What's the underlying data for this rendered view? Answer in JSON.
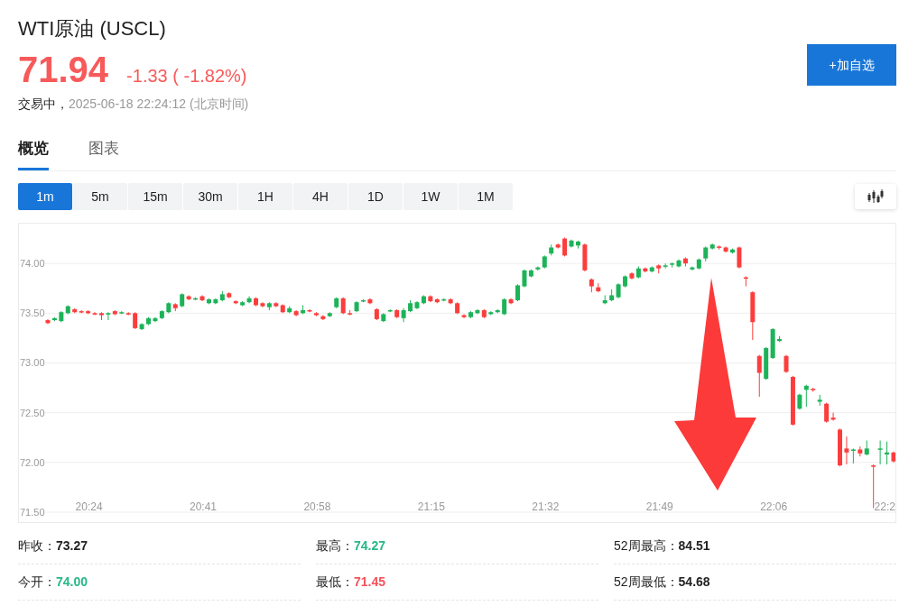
{
  "header": {
    "title": "WTI原油 (USCL)",
    "price": "71.94",
    "change": "-1.33 ( -1.82%)",
    "status": "交易中，",
    "timestamp": "2025-06-18 22:24:12 (北京时间)",
    "watch_button": "+加自选"
  },
  "tabs": [
    {
      "label": "概览",
      "selected": true
    },
    {
      "label": "图表",
      "selected": false
    }
  ],
  "intervals": [
    {
      "label": "1m",
      "selected": true
    },
    {
      "label": "5m",
      "selected": false
    },
    {
      "label": "15m",
      "selected": false
    },
    {
      "label": "30m",
      "selected": false
    },
    {
      "label": "1H",
      "selected": false
    },
    {
      "label": "4H",
      "selected": false
    },
    {
      "label": "1D",
      "selected": false
    },
    {
      "label": "1W",
      "selected": false
    },
    {
      "label": "1M",
      "selected": false
    }
  ],
  "chart": {
    "chart_data": {
      "type": "candlestick",
      "grid": true,
      "xlim": [
        1213.7,
        1344.27
      ],
      "ylim": [
        71.4,
        74.4
      ],
      "yticks": [
        {
          "value": 74,
          "label": "74.00"
        },
        {
          "value": 73.5,
          "label": "73.50"
        },
        {
          "value": 73,
          "label": "73.00"
        },
        {
          "value": 72.5,
          "label": "72.50"
        },
        {
          "value": 72,
          "label": "72.00"
        },
        {
          "value": 71.5,
          "label": "71.50"
        }
      ],
      "xticks": [
        {
          "value": 1224,
          "label": "20:24"
        },
        {
          "value": 1241,
          "label": "20:41"
        },
        {
          "value": 1258,
          "label": "20:58"
        },
        {
          "value": 1275,
          "label": "21:15"
        },
        {
          "value": 1292,
          "label": "21:32"
        },
        {
          "value": 1309,
          "label": "21:49"
        },
        {
          "value": 1326,
          "label": "22:06"
        },
        {
          "value": 1343,
          "label": "22:2"
        }
      ],
      "x": [
        1218,
        1219,
        1220,
        1221,
        1222,
        1223,
        1224,
        1225,
        1226,
        1227,
        1228,
        1229,
        1230,
        1231,
        1232,
        1233,
        1234,
        1235,
        1236,
        1237,
        1238,
        1239,
        1240,
        1241,
        1242,
        1243,
        1244,
        1245,
        1246,
        1247,
        1248,
        1249,
        1250,
        1251,
        1252,
        1253,
        1254,
        1255,
        1256,
        1257,
        1258,
        1259,
        1260,
        1261,
        1262,
        1263,
        1264,
        1265,
        1266,
        1267,
        1268,
        1269,
        1270,
        1271,
        1272,
        1273,
        1274,
        1275,
        1276,
        1277,
        1278,
        1279,
        1280,
        1281,
        1282,
        1283,
        1284,
        1285,
        1286,
        1287,
        1288,
        1289,
        1290,
        1291,
        1292,
        1293,
        1294,
        1295,
        1296,
        1297,
        1298,
        1299,
        1300,
        1301,
        1302,
        1303,
        1304,
        1305,
        1306,
        1307,
        1308,
        1309,
        1310,
        1311,
        1312,
        1313,
        1314,
        1315,
        1316,
        1317,
        1318,
        1319,
        1320,
        1321,
        1322,
        1323,
        1324,
        1325,
        1326,
        1327,
        1328,
        1329,
        1330,
        1331,
        1332,
        1333,
        1334,
        1335,
        1336,
        1337,
        1338,
        1339,
        1340,
        1341,
        1342,
        1343,
        1344
      ],
      "ohlc": [
        [
          73.43,
          73.44,
          73.39,
          73.4
        ],
        [
          73.43,
          73.46,
          73.42,
          73.45
        ],
        [
          73.42,
          73.52,
          73.41,
          73.51
        ],
        [
          73.5,
          73.58,
          73.49,
          73.57
        ],
        [
          73.54,
          73.55,
          73.5,
          73.51
        ],
        [
          73.52,
          73.53,
          73.5,
          73.51
        ],
        [
          73.52,
          73.53,
          73.49,
          73.5
        ],
        [
          73.5,
          73.51,
          73.48,
          73.49
        ],
        [
          73.5,
          73.51,
          73.43,
          73.48
        ],
        [
          73.49,
          73.51,
          73.43,
          73.5
        ],
        [
          73.52,
          73.53,
          73.48,
          73.49
        ],
        [
          73.5,
          73.52,
          73.49,
          73.51
        ],
        [
          73.5,
          73.51,
          73.48,
          73.49
        ],
        [
          73.5,
          73.51,
          73.34,
          73.35
        ],
        [
          73.34,
          73.4,
          73.33,
          73.39
        ],
        [
          73.39,
          73.46,
          73.38,
          73.45
        ],
        [
          73.42,
          73.46,
          73.41,
          73.45
        ],
        [
          73.45,
          73.53,
          73.44,
          73.52
        ],
        [
          73.51,
          73.61,
          73.5,
          73.6
        ],
        [
          73.59,
          73.6,
          73.52,
          73.55
        ],
        [
          73.57,
          73.7,
          73.56,
          73.69
        ],
        [
          73.67,
          73.68,
          73.63,
          73.64
        ],
        [
          73.64,
          73.66,
          73.63,
          73.65
        ],
        [
          73.67,
          73.68,
          73.62,
          73.63
        ],
        [
          73.6,
          73.65,
          73.59,
          73.64
        ],
        [
          73.6,
          73.65,
          73.59,
          73.64
        ],
        [
          73.63,
          73.72,
          73.62,
          73.69
        ],
        [
          73.7,
          73.71,
          73.65,
          73.66
        ],
        [
          73.62,
          73.63,
          73.59,
          73.6
        ],
        [
          73.58,
          73.62,
          73.57,
          73.61
        ],
        [
          73.61,
          73.67,
          73.6,
          73.65
        ],
        [
          73.65,
          73.66,
          73.57,
          73.58
        ],
        [
          73.6,
          73.61,
          73.56,
          73.57
        ],
        [
          73.56,
          73.61,
          73.53,
          73.6
        ],
        [
          73.6,
          73.61,
          73.56,
          73.57
        ],
        [
          73.58,
          73.59,
          73.5,
          73.51
        ],
        [
          73.51,
          73.57,
          73.5,
          73.55
        ],
        [
          73.52,
          73.53,
          73.47,
          73.48
        ],
        [
          73.5,
          73.58,
          73.49,
          73.53
        ],
        [
          73.53,
          73.54,
          73.51,
          73.52
        ],
        [
          73.5,
          73.51,
          73.47,
          73.48
        ],
        [
          73.47,
          73.48,
          73.43,
          73.44
        ],
        [
          73.47,
          73.51,
          73.46,
          73.5
        ],
        [
          73.56,
          73.66,
          73.55,
          73.65
        ],
        [
          73.65,
          73.66,
          73.49,
          73.5
        ],
        [
          73.5,
          73.53,
          73.48,
          73.49
        ],
        [
          73.52,
          73.62,
          73.51,
          73.61
        ],
        [
          73.62,
          73.64,
          73.61,
          73.63
        ],
        [
          73.64,
          73.65,
          73.59,
          73.6
        ],
        [
          73.54,
          73.55,
          73.43,
          73.44
        ],
        [
          73.42,
          73.5,
          73.41,
          73.49
        ],
        [
          73.52,
          73.54,
          73.51,
          73.53
        ],
        [
          73.53,
          73.54,
          73.45,
          73.46
        ],
        [
          73.45,
          73.55,
          73.41,
          73.53
        ],
        [
          73.52,
          73.63,
          73.51,
          73.6
        ],
        [
          73.55,
          73.62,
          73.54,
          73.61
        ],
        [
          73.6,
          73.68,
          73.59,
          73.67
        ],
        [
          73.67,
          73.68,
          73.61,
          73.62
        ],
        [
          73.64,
          73.65,
          73.6,
          73.61
        ],
        [
          73.63,
          73.65,
          73.62,
          73.64
        ],
        [
          73.64,
          73.65,
          73.59,
          73.6
        ],
        [
          73.6,
          73.61,
          73.49,
          73.5
        ],
        [
          73.48,
          73.49,
          73.45,
          73.46
        ],
        [
          73.46,
          73.52,
          73.45,
          73.51
        ],
        [
          73.5,
          73.54,
          73.49,
          73.53
        ],
        [
          73.53,
          73.54,
          73.45,
          73.46
        ],
        [
          73.49,
          73.52,
          73.48,
          73.51
        ],
        [
          73.51,
          73.54,
          73.5,
          73.53
        ],
        [
          73.49,
          73.65,
          73.48,
          73.64
        ],
        [
          73.64,
          73.65,
          73.59,
          73.6
        ],
        [
          73.63,
          73.79,
          73.62,
          73.78
        ],
        [
          73.77,
          73.94,
          73.76,
          73.93
        ],
        [
          73.87,
          73.94,
          73.86,
          73.93
        ],
        [
          73.94,
          73.97,
          73.93,
          73.96
        ],
        [
          73.96,
          74.08,
          73.95,
          74.07
        ],
        [
          74.1,
          74.19,
          74.08,
          74.16
        ],
        [
          74.19,
          74.2,
          74.15,
          74.16
        ],
        [
          74.25,
          74.26,
          74.07,
          74.08
        ],
        [
          74.17,
          74.24,
          74.16,
          74.23
        ],
        [
          74.18,
          74.23,
          74.15,
          74.22
        ],
        [
          74.19,
          74.2,
          73.92,
          73.93
        ],
        [
          73.84,
          73.85,
          73.71,
          73.77
        ],
        [
          73.76,
          73.8,
          73.71,
          73.72
        ],
        [
          73.6,
          73.68,
          73.59,
          73.63
        ],
        [
          73.63,
          73.74,
          73.62,
          73.68
        ],
        [
          73.66,
          73.8,
          73.65,
          73.79
        ],
        [
          73.77,
          73.88,
          73.76,
          73.87
        ],
        [
          73.9,
          73.91,
          73.84,
          73.85
        ],
        [
          73.86,
          73.97,
          73.85,
          73.95
        ],
        [
          73.95,
          73.96,
          73.91,
          73.92
        ],
        [
          73.92,
          73.97,
          73.91,
          73.96
        ],
        [
          73.98,
          73.99,
          73.9,
          73.95
        ],
        [
          73.97,
          74.0,
          73.95,
          73.98
        ],
        [
          73.99,
          74.01,
          73.96,
          74.0
        ],
        [
          73.97,
          74.04,
          73.96,
          74.03
        ],
        [
          74.05,
          74.06,
          73.97,
          74.0
        ],
        [
          73.94,
          73.97,
          73.93,
          73.96
        ],
        [
          73.95,
          74.05,
          73.94,
          74.04
        ],
        [
          74.05,
          74.17,
          74.02,
          74.16
        ],
        [
          74.15,
          74.2,
          74.14,
          74.19
        ],
        [
          74.17,
          74.18,
          74.14,
          74.16
        ],
        [
          74.16,
          74.17,
          74.11,
          74.12
        ],
        [
          74.11,
          74.15,
          74.1,
          74.14
        ],
        [
          74.16,
          74.17,
          73.95,
          73.96
        ],
        [
          73.86,
          73.87,
          73.77,
          73.85
        ],
        [
          73.71,
          73.72,
          73.23,
          73.41
        ],
        [
          73.07,
          73.08,
          72.66,
          72.9
        ],
        [
          72.84,
          73.16,
          72.83,
          73.15
        ],
        [
          73.05,
          73.35,
          73.04,
          73.34
        ],
        [
          73.22,
          73.27,
          73.21,
          73.24
        ],
        [
          73.07,
          73.08,
          72.9,
          72.91
        ],
        [
          72.86,
          72.87,
          72.37,
          72.38
        ],
        [
          72.54,
          72.69,
          72.53,
          72.68
        ],
        [
          72.73,
          72.78,
          72.56,
          72.77
        ],
        [
          72.74,
          72.75,
          72.71,
          72.73
        ],
        [
          72.61,
          72.68,
          72.57,
          72.63
        ],
        [
          72.59,
          72.6,
          72.4,
          72.41
        ],
        [
          72.45,
          72.5,
          72.42,
          72.43
        ],
        [
          72.33,
          72.34,
          71.96,
          71.97
        ],
        [
          72.14,
          72.26,
          71.98,
          72.1
        ],
        [
          72.12,
          72.14,
          71.99,
          72.13
        ],
        [
          72.13,
          72.16,
          72.06,
          72.09
        ],
        [
          72.08,
          72.22,
          72.07,
          72.14
        ],
        [
          71.97,
          71.98,
          71.54,
          71.96
        ],
        [
          72.13,
          72.22,
          71.98,
          72.14
        ],
        [
          72.08,
          72.21,
          71.98,
          72.1
        ],
        [
          72.1,
          72.11,
          72.0,
          72.01
        ]
      ]
    }
  },
  "stats": [
    {
      "label": "昨收：",
      "value": "73.27",
      "color": "#222222"
    },
    {
      "label": "最高：",
      "value": "74.27",
      "color": "#26b886"
    },
    {
      "label": "52周最高：",
      "value": "84.51",
      "color": "#222222"
    },
    {
      "label": "今开：",
      "value": "74.00",
      "color": "#26b886"
    },
    {
      "label": "最低：",
      "value": "71.45",
      "color": "#f5525b"
    },
    {
      "label": "52周最低：",
      "value": "54.68",
      "color": "#222222"
    }
  ]
}
